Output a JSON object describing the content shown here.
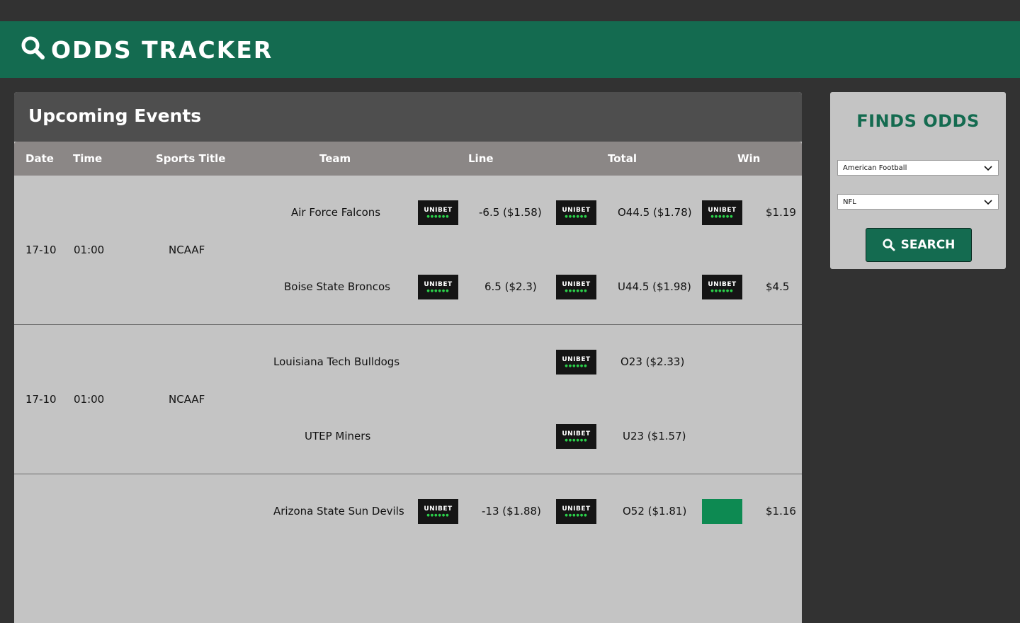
{
  "app": {
    "title": "ODDS TRACKER"
  },
  "events": {
    "title": "Upcoming Events",
    "columns": [
      "Date",
      "Time",
      "Sports Title",
      "Team",
      "Line",
      "Total",
      "Win"
    ],
    "groups": [
      {
        "date": "17-10",
        "time": "01:00",
        "sport": "NCAAF",
        "rows": [
          {
            "team": "Air Force Falcons",
            "line_book": "UNIBET",
            "line": "-6.5 ($1.58)",
            "total_book": "UNIBET",
            "total": "O44.5 ($1.78)",
            "win_book": "UNIBET",
            "win": "$1.19"
          },
          {
            "team": "Boise State Broncos",
            "line_book": "UNIBET",
            "line": "6.5 ($2.3)",
            "total_book": "UNIBET",
            "total": "U44.5 ($1.98)",
            "win_book": "UNIBET",
            "win": "$4.5"
          }
        ]
      },
      {
        "date": "17-10",
        "time": "01:00",
        "sport": "NCAAF",
        "rows": [
          {
            "team": "Louisiana Tech Bulldogs",
            "total_book": "UNIBET",
            "total": "O23 ($2.33)"
          },
          {
            "team": "UTEP Miners",
            "total_book": "UNIBET",
            "total": "U23 ($1.57)"
          }
        ]
      },
      {
        "rows": [
          {
            "team": "Arizona State Sun Devils",
            "line_book": "UNIBET",
            "line": "-13 ($1.88)",
            "total_book": "UNIBET",
            "total": "O52 ($1.81)",
            "win_book": "green-logo",
            "win": "$1.16"
          }
        ]
      }
    ]
  },
  "finds": {
    "title": "FINDS ODDS",
    "sport_select": "American Football",
    "league_select": "NFL",
    "search_label": "SEARCH"
  },
  "colors": {
    "brand": "#146b50",
    "bg": "#323232",
    "panel": "#c4c4c4"
  }
}
